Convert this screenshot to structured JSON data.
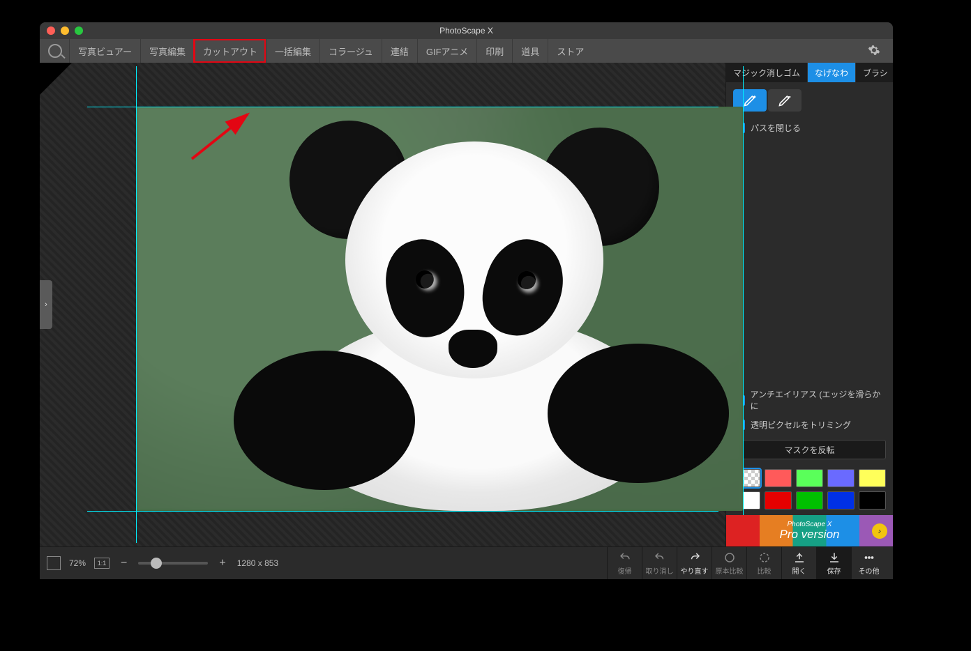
{
  "window": {
    "title": "PhotoScape X"
  },
  "tabs": {
    "items": [
      "写真ビュアー",
      "写真編集",
      "カットアウト",
      "一括編集",
      "コラージュ",
      "連結",
      "GIFアニメ",
      "印刷",
      "道具",
      "ストア"
    ],
    "highlighted_index": 2
  },
  "pro_badge": "PRO Version",
  "canvas": {
    "zoom_percent": "72%",
    "ratio_label": "1:1",
    "dimensions": "1280 x 853"
  },
  "right_panel": {
    "tool_tabs": {
      "items": [
        "マジック消しゴム",
        "なげなわ",
        "ブラシ"
      ],
      "active_index": 1
    },
    "close_path": "パスを閉じる",
    "antialias": "アンチエイリアス (エッジを滑らかに",
    "trim_transparent": "透明ピクセルをトリミング",
    "invert_mask": "マスクを反転",
    "swatch_colors": [
      "checker",
      "#ff5a5a",
      "#5aff5a",
      "#6a6aff",
      "#ffff5a",
      "#ffffff",
      "#e60000",
      "#00c000",
      "#0030e6",
      "#000000"
    ],
    "ad_line1": "PhotoScape X",
    "ad_line2": "Pro version"
  },
  "bottom_actions": {
    "undo_all": "復帰",
    "undo": "取り消し",
    "redo": "やり直す",
    "compare_orig": "原本比較",
    "compare": "比較",
    "open": "開く",
    "save": "保存",
    "more": "その他"
  }
}
